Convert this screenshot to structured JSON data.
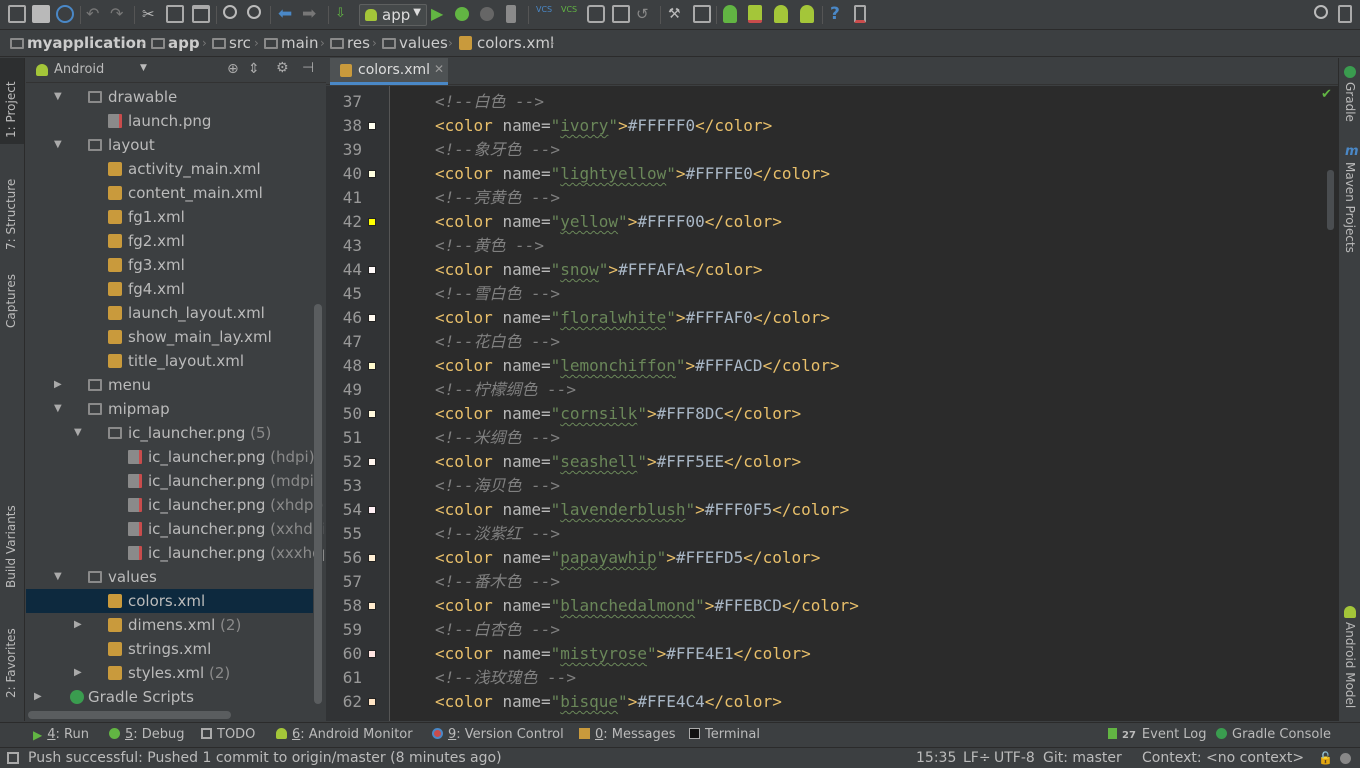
{
  "toolbar": {
    "run_config": "app",
    "icons": [
      "open-icon",
      "save-icon",
      "sync-icon",
      "undo-icon",
      "redo-icon",
      "cut-icon",
      "copy-icon",
      "paste-icon",
      "find-icon",
      "replace-icon",
      "back-icon",
      "forward-icon",
      "make-icon",
      "run-icon",
      "debug-icon",
      "attach-icon",
      "coverage-icon",
      "vcs-update-icon",
      "vcs-commit-icon",
      "vcs-history-icon",
      "vcs-compare-icon",
      "revert-icon",
      "sdk-manager-icon",
      "project-structure-icon",
      "avd-manager-icon",
      "android-device-monitor-icon",
      "android-icon",
      "help-icon",
      "device-icon",
      "search-everywhere-icon"
    ]
  },
  "breadcrumb": {
    "items": [
      "myapplication",
      "app",
      "src",
      "main",
      "res",
      "values",
      "colors.xml"
    ]
  },
  "left_strip": {
    "tabs": [
      "1: Project",
      "7: Structure",
      "Captures",
      "Build Variants",
      "2: Favorites"
    ]
  },
  "right_strip": {
    "tabs": [
      "Gradle",
      "Maven Projects",
      "Android Model"
    ]
  },
  "project_panel": {
    "view_mode": "Android",
    "tree": [
      {
        "indent": 1,
        "arrow": "▼",
        "icon": "folder",
        "label": "drawable",
        "qual": ""
      },
      {
        "indent": 2,
        "arrow": "",
        "icon": "png",
        "label": "launch.png",
        "qual": ""
      },
      {
        "indent": 1,
        "arrow": "▼",
        "icon": "folder",
        "label": "layout",
        "qual": ""
      },
      {
        "indent": 2,
        "arrow": "",
        "icon": "xml",
        "label": "activity_main.xml",
        "qual": ""
      },
      {
        "indent": 2,
        "arrow": "",
        "icon": "xml",
        "label": "content_main.xml",
        "qual": ""
      },
      {
        "indent": 2,
        "arrow": "",
        "icon": "xml",
        "label": "fg1.xml",
        "qual": ""
      },
      {
        "indent": 2,
        "arrow": "",
        "icon": "xml",
        "label": "fg2.xml",
        "qual": ""
      },
      {
        "indent": 2,
        "arrow": "",
        "icon": "xml",
        "label": "fg3.xml",
        "qual": ""
      },
      {
        "indent": 2,
        "arrow": "",
        "icon": "xml",
        "label": "fg4.xml",
        "qual": ""
      },
      {
        "indent": 2,
        "arrow": "",
        "icon": "xml",
        "label": "launch_layout.xml",
        "qual": ""
      },
      {
        "indent": 2,
        "arrow": "",
        "icon": "xml",
        "label": "show_main_lay.xml",
        "qual": ""
      },
      {
        "indent": 2,
        "arrow": "",
        "icon": "xml",
        "label": "title_layout.xml",
        "qual": ""
      },
      {
        "indent": 1,
        "arrow": "▶",
        "icon": "folder",
        "label": "menu",
        "qual": ""
      },
      {
        "indent": 1,
        "arrow": "▼",
        "icon": "folder",
        "label": "mipmap",
        "qual": ""
      },
      {
        "indent": 2,
        "arrow": "▼",
        "icon": "folder",
        "label": "ic_launcher.png",
        "qual": " (5)"
      },
      {
        "indent": 3,
        "arrow": "",
        "icon": "png",
        "label": "ic_launcher.png",
        "qual": " (hdpi)"
      },
      {
        "indent": 3,
        "arrow": "",
        "icon": "png",
        "label": "ic_launcher.png",
        "qual": " (mdpi)"
      },
      {
        "indent": 3,
        "arrow": "",
        "icon": "png",
        "label": "ic_launcher.png",
        "qual": " (xhdpi)"
      },
      {
        "indent": 3,
        "arrow": "",
        "icon": "png",
        "label": "ic_launcher.png",
        "qual": " (xxhdpi)"
      },
      {
        "indent": 3,
        "arrow": "",
        "icon": "png",
        "label": "ic_launcher.png",
        "qual": " (xxxhdp"
      },
      {
        "indent": 1,
        "arrow": "▼",
        "icon": "folder",
        "label": "values",
        "qual": ""
      },
      {
        "indent": 2,
        "arrow": "",
        "icon": "xml",
        "label": "colors.xml",
        "qual": "",
        "selected": true
      },
      {
        "indent": 2,
        "arrow": "▶",
        "icon": "xml",
        "label": "dimens.xml",
        "qual": " (2)"
      },
      {
        "indent": 2,
        "arrow": "",
        "icon": "xml",
        "label": "strings.xml",
        "qual": ""
      },
      {
        "indent": 2,
        "arrow": "▶",
        "icon": "xml",
        "label": "styles.xml",
        "qual": " (2)"
      },
      {
        "indent": 0,
        "arrow": "▶",
        "icon": "gradle",
        "label": "Gradle Scripts",
        "qual": ""
      }
    ]
  },
  "editor": {
    "tab_label": "colors.xml",
    "lines": [
      {
        "n": "37",
        "kind": "comment",
        "text": "<!--白色 -->"
      },
      {
        "n": "38",
        "kind": "color",
        "name": "ivory",
        "value": "#FFFFF0",
        "swatch": "#FFFFF0"
      },
      {
        "n": "39",
        "kind": "comment",
        "text": "<!--象牙色 -->"
      },
      {
        "n": "40",
        "kind": "color",
        "name": "lightyellow",
        "value": "#FFFFE0",
        "swatch": "#FFFFE0"
      },
      {
        "n": "41",
        "kind": "comment",
        "text": "<!--亮黄色 -->"
      },
      {
        "n": "42",
        "kind": "color",
        "name": "yellow",
        "value": "#FFFF00",
        "swatch": "#FFFF00"
      },
      {
        "n": "43",
        "kind": "comment",
        "text": "<!--黄色 -->"
      },
      {
        "n": "44",
        "kind": "color",
        "name": "snow",
        "value": "#FFFAFA",
        "swatch": "#FFFAFA"
      },
      {
        "n": "45",
        "kind": "comment",
        "text": "<!--雪白色 -->"
      },
      {
        "n": "46",
        "kind": "color",
        "name": "floralwhite",
        "value": "#FFFAF0",
        "swatch": "#FFFAF0"
      },
      {
        "n": "47",
        "kind": "comment",
        "text": "<!--花白色 -->"
      },
      {
        "n": "48",
        "kind": "color",
        "name": "lemonchiffon",
        "value": "#FFFACD",
        "swatch": "#FFFACD"
      },
      {
        "n": "49",
        "kind": "comment",
        "text": "<!--柠檬绸色 -->"
      },
      {
        "n": "50",
        "kind": "color",
        "name": "cornsilk",
        "value": "#FFF8DC",
        "swatch": "#FFF8DC"
      },
      {
        "n": "51",
        "kind": "comment",
        "text": "<!--米绸色 -->"
      },
      {
        "n": "52",
        "kind": "color",
        "name": "seashell",
        "value": "#FFF5EE",
        "swatch": "#FFF5EE"
      },
      {
        "n": "53",
        "kind": "comment",
        "text": "<!--海贝色 -->"
      },
      {
        "n": "54",
        "kind": "color",
        "name": "lavenderblush",
        "value": "#FFF0F5",
        "swatch": "#FFF0F5"
      },
      {
        "n": "55",
        "kind": "comment",
        "text": "<!--淡紫红 -->"
      },
      {
        "n": "56",
        "kind": "color",
        "name": "papayawhip",
        "value": "#FFEFD5",
        "swatch": "#FFEFD5"
      },
      {
        "n": "57",
        "kind": "comment",
        "text": "<!--番木色 -->"
      },
      {
        "n": "58",
        "kind": "color",
        "name": "blanchedalmond",
        "value": "#FFEBCD",
        "swatch": "#FFEBCD"
      },
      {
        "n": "59",
        "kind": "comment",
        "text": "<!--白杏色 -->"
      },
      {
        "n": "60",
        "kind": "color",
        "name": "mistyrose",
        "value": "#FFE4E1",
        "swatch": "#FFE4E1"
      },
      {
        "n": "61",
        "kind": "comment",
        "text": "<!--浅玫瑰色 -->"
      },
      {
        "n": "62",
        "kind": "color",
        "name": "bisque",
        "value": "#FFE4C4",
        "swatch": "#FFE4C4"
      }
    ]
  },
  "bottom_tools": {
    "run": {
      "num": "4",
      "label": ": Run"
    },
    "debug": {
      "num": "5",
      "label": ": Debug"
    },
    "todo": {
      "label": "TODO"
    },
    "android_monitor": {
      "num": "6",
      "label": ": Android Monitor"
    },
    "version_control": {
      "num": "9",
      "label": ": Version Control"
    },
    "messages": {
      "num": "0",
      "label": ": Messages"
    },
    "terminal": {
      "label": "Terminal"
    },
    "event_log": {
      "count": "27",
      "label": "Event Log"
    },
    "gradle_console": {
      "label": "Gradle Console"
    }
  },
  "status_bar": {
    "message": "Push successful: Pushed 1 commit to origin/master (8 minutes ago)",
    "position": "15:35",
    "line_separator": "LF÷",
    "encoding": "UTF-8",
    "git_branch": "Git: master",
    "context": "Context: <no context>"
  },
  "colors": {
    "accent": "#4a88c7",
    "selection": "#0d293e",
    "xml_tag": "#e8bf6a",
    "xml_string": "#6a8759",
    "comment": "#808080"
  }
}
